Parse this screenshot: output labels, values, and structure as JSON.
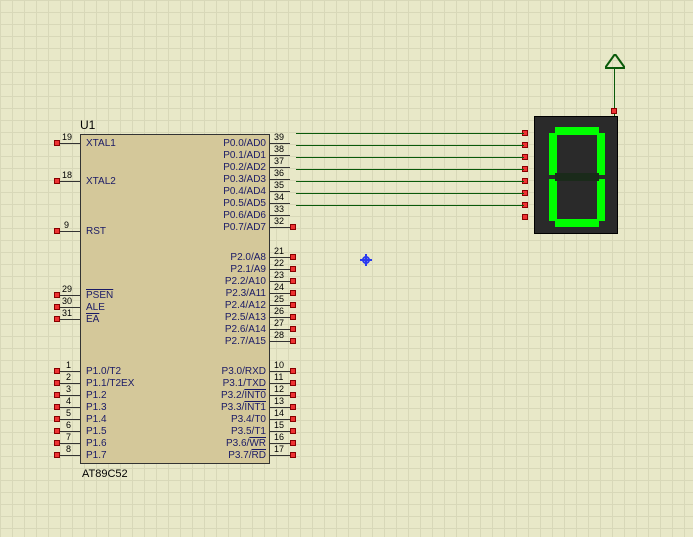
{
  "component": {
    "ref": "U1",
    "part": "AT89C52",
    "left_pins": [
      {
        "label": "XTAL1",
        "num": "19"
      },
      {
        "label": "XTAL2",
        "num": "18"
      },
      {
        "label": "RST",
        "num": "9"
      },
      {
        "label": "PSEN",
        "num": "29",
        "overline": true
      },
      {
        "label": "ALE",
        "num": "30"
      },
      {
        "label": "EA",
        "num": "31",
        "overline": true
      },
      {
        "label": "P1.0/T2",
        "num": "1"
      },
      {
        "label": "P1.1/T2EX",
        "num": "2"
      },
      {
        "label": "P1.2",
        "num": "3"
      },
      {
        "label": "P1.3",
        "num": "4"
      },
      {
        "label": "P1.4",
        "num": "5"
      },
      {
        "label": "P1.5",
        "num": "6"
      },
      {
        "label": "P1.6",
        "num": "7"
      },
      {
        "label": "P1.7",
        "num": "8"
      }
    ],
    "right_pins": [
      {
        "label": "P0.0/AD0",
        "num": "39"
      },
      {
        "label": "P0.1/AD1",
        "num": "38"
      },
      {
        "label": "P0.2/AD2",
        "num": "37"
      },
      {
        "label": "P0.3/AD3",
        "num": "36"
      },
      {
        "label": "P0.4/AD4",
        "num": "35"
      },
      {
        "label": "P0.5/AD5",
        "num": "34"
      },
      {
        "label": "P0.6/AD6",
        "num": "33"
      },
      {
        "label": "P0.7/AD7",
        "num": "32"
      },
      {
        "label": "P2.0/A8",
        "num": "21"
      },
      {
        "label": "P2.1/A9",
        "num": "22"
      },
      {
        "label": "P2.2/A10",
        "num": "23"
      },
      {
        "label": "P2.3/A11",
        "num": "24"
      },
      {
        "label": "P2.4/A12",
        "num": "25"
      },
      {
        "label": "P2.5/A13",
        "num": "26"
      },
      {
        "label": "P2.6/A14",
        "num": "27"
      },
      {
        "label": "P2.7/A15",
        "num": "28"
      },
      {
        "label": "P3.0/RXD",
        "num": "10"
      },
      {
        "label": "P3.1/TXD",
        "num": "11"
      },
      {
        "label": "P3.2/INT0",
        "num": "12",
        "overline_part": "INT0"
      },
      {
        "label": "P3.3/INT1",
        "num": "13",
        "overline_part": "INT1"
      },
      {
        "label": "P3.4/T0",
        "num": "14"
      },
      {
        "label": "P3.5/T1",
        "num": "15"
      },
      {
        "label": "P3.6/WR",
        "num": "16",
        "overline_part": "WR"
      },
      {
        "label": "P3.7/RD",
        "num": "17",
        "overline_part": "RD"
      }
    ]
  },
  "sevenseg": {
    "value": "0",
    "segments": {
      "a": true,
      "b": true,
      "c": true,
      "d": true,
      "e": true,
      "f": true,
      "g": false
    }
  },
  "wires_count": 7
}
